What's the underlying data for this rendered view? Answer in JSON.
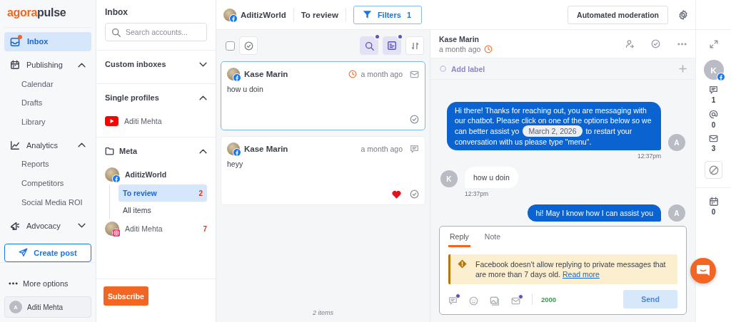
{
  "logo": {
    "first": "agora",
    "second": "pulse"
  },
  "nav": {
    "items": [
      {
        "label": "Inbox",
        "selected": true,
        "notify": true
      },
      {
        "label": "Publishing",
        "selected": false,
        "expanded": true,
        "children": [
          {
            "label": "Calendar"
          },
          {
            "label": "Drafts"
          },
          {
            "label": "Library"
          }
        ]
      },
      {
        "label": "Analytics",
        "selected": false,
        "expanded": true,
        "children": [
          {
            "label": "Reports"
          },
          {
            "label": "Competitors"
          },
          {
            "label": "Social Media ROI"
          }
        ]
      },
      {
        "label": "Advocacy",
        "selected": false,
        "expanded": false
      }
    ],
    "create_button": "Create post",
    "more": "More options",
    "user": {
      "initial": "A",
      "name": "Aditi Mehta"
    }
  },
  "inbox": {
    "title": "Inbox",
    "search": {
      "placeholder": "Search accounts..."
    },
    "sections": [
      {
        "title": "Custom inboxes",
        "kind": "group",
        "expanded": false
      },
      {
        "title": "Single profiles",
        "kind": "group",
        "expanded": true,
        "profiles": [
          {
            "name": "Aditi Mehta",
            "kind": "youtube"
          }
        ]
      },
      {
        "title": "Meta",
        "kind": "folder",
        "expanded": true,
        "profiles": [
          {
            "name": "AditizWorld",
            "kind": "facebook",
            "children": [
              {
                "label": "To review",
                "count": "2",
                "selected": true
              },
              {
                "label": "All items",
                "selected": false
              }
            ]
          },
          {
            "name": "Aditi Mehta",
            "kind": "instagram",
            "count": "7"
          }
        ]
      }
    ],
    "subscribe": "Subscribe"
  },
  "header": {
    "account": "AditizWorld",
    "view": "To review",
    "filters": {
      "label": "Filters",
      "count": "1"
    },
    "moderation": "Automated moderation"
  },
  "list": {
    "select_all": {
      "checked": false
    },
    "items": [
      {
        "author": "Kase Marin",
        "time": "a month ago",
        "pending": true,
        "kind": "message",
        "text": "how u doin",
        "liked": false,
        "selected": true
      },
      {
        "author": "Kase Marin",
        "time": "a month ago",
        "pending": false,
        "kind": "comment",
        "text": "heyy",
        "liked": true,
        "selected": false
      }
    ],
    "footer": "2 items"
  },
  "conversation": {
    "author": "Kase Marin",
    "time": "a month ago",
    "pending": true,
    "label_placeholder": "Add label",
    "messages": [
      {
        "kind": "outgoing",
        "initial": "A",
        "text": "Hi there! Thanks for reaching out, you are messaging with our chatbot. Please click on one of the options below so we can better assist yo",
        "date": "March 2, 2026",
        "text_after": "to restart your conversation with us please type \"menu\".",
        "time": "12:37pm"
      },
      {
        "kind": "incoming",
        "initial": "K",
        "text": "how u doin",
        "time": "12:37pm"
      },
      {
        "kind": "outgoing",
        "initial": "A",
        "text": "hi! May I know how I can assist you"
      }
    ],
    "composer": {
      "tabs": [
        {
          "label": "Reply",
          "selected": true
        },
        {
          "label": "Note",
          "selected": false
        }
      ],
      "warning": "Facebook doesn't allow replying to private messages that are more than 7 days old.",
      "warning_link": "Read more",
      "char_count": "2000",
      "send": {
        "label": "Send",
        "disabled": true
      }
    }
  },
  "rail": {
    "initial": "K",
    "stats": [
      {
        "count": "1"
      },
      {
        "count": "0"
      },
      {
        "count": "3"
      }
    ],
    "calendar_count": "0"
  }
}
